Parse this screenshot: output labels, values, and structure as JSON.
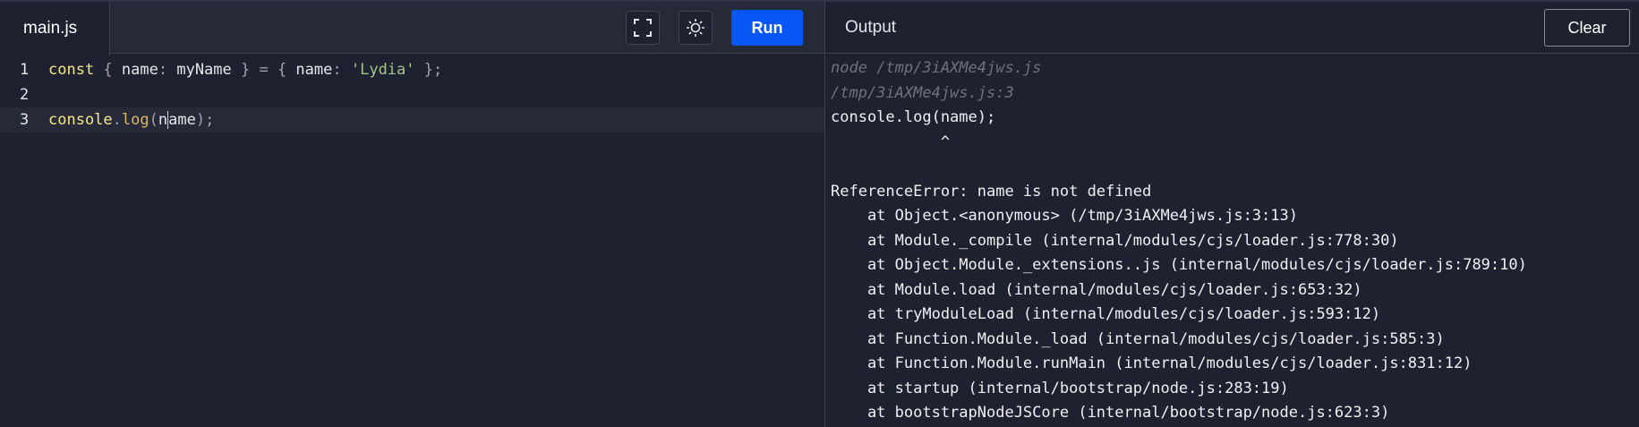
{
  "editor": {
    "file_tab": "main.js",
    "run_label": "Run",
    "lines": [
      {
        "number": "1",
        "tokens": [
          {
            "t": "const",
            "c": "kw"
          },
          {
            "t": " { ",
            "c": "punc"
          },
          {
            "t": "name",
            "c": "plain"
          },
          {
            "t": ": ",
            "c": "punc"
          },
          {
            "t": "myName",
            "c": "plain"
          },
          {
            "t": " } = { ",
            "c": "punc"
          },
          {
            "t": "name",
            "c": "plain"
          },
          {
            "t": ": ",
            "c": "punc"
          },
          {
            "t": "'Lydia'",
            "c": "str"
          },
          {
            "t": " };",
            "c": "punc"
          }
        ]
      },
      {
        "number": "2",
        "tokens": []
      },
      {
        "number": "3",
        "active": true,
        "tokens": [
          {
            "t": "console",
            "c": "fn"
          },
          {
            "t": ".",
            "c": "punc"
          },
          {
            "t": "log",
            "c": "mem"
          },
          {
            "t": "(",
            "c": "punc"
          },
          {
            "t": "n",
            "c": "plain"
          },
          {
            "t": "|cursor|",
            "c": "cursor"
          },
          {
            "t": "ame",
            "c": "plain"
          },
          {
            "t": ");",
            "c": "punc"
          }
        ]
      }
    ]
  },
  "output": {
    "title": "Output",
    "clear_label": "Clear",
    "lines": [
      {
        "text": "node /tmp/3iAXMe4jws.js",
        "dim": true
      },
      {
        "text": "/tmp/3iAXMe4jws.js:3",
        "dim": true
      },
      {
        "text": "console.log(name);"
      },
      {
        "text": "            ^"
      },
      {
        "text": ""
      },
      {
        "text": "ReferenceError: name is not defined"
      },
      {
        "text": "    at Object.<anonymous> (/tmp/3iAXMe4jws.js:3:13)"
      },
      {
        "text": "    at Module._compile (internal/modules/cjs/loader.js:778:30)"
      },
      {
        "text": "    at Object.Module._extensions..js (internal/modules/cjs/loader.js:789:10)"
      },
      {
        "text": "    at Module.load (internal/modules/cjs/loader.js:653:32)"
      },
      {
        "text": "    at tryModuleLoad (internal/modules/cjs/loader.js:593:12)"
      },
      {
        "text": "    at Function.Module._load (internal/modules/cjs/loader.js:585:3)"
      },
      {
        "text": "    at Function.Module.runMain (internal/modules/cjs/loader.js:831:12)"
      },
      {
        "text": "    at startup (internal/bootstrap/node.js:283:19)"
      },
      {
        "text": "    at bootstrapNodeJSCore (internal/bootstrap/node.js:623:3)"
      }
    ]
  },
  "icons": {
    "fullscreen": "fullscreen-icon",
    "theme": "sun-icon"
  },
  "colors": {
    "run_button": "#0556f3",
    "background": "#1d2130"
  }
}
